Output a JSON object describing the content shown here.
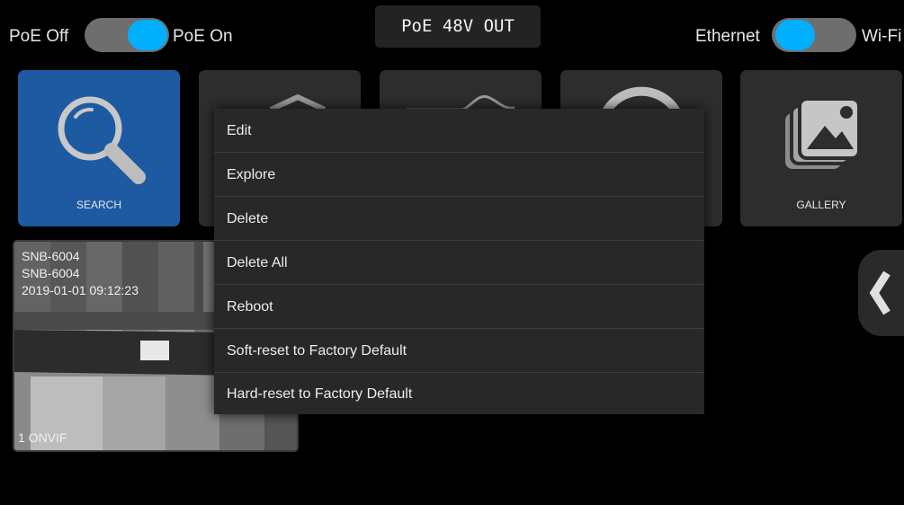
{
  "topbar": {
    "poe_off_label": "PoE Off",
    "poe_on_label": "PoE On",
    "poe_status": "PoE 48V OUT",
    "ethernet_label": "Ethernet",
    "wifi_label": "Wi-Fi",
    "poe_switch_state": "on",
    "net_switch_state": "ethernet"
  },
  "tiles": [
    {
      "label": "SEARCH",
      "icon": "magnifier-icon"
    },
    {
      "label": "",
      "icon": "video-icon"
    },
    {
      "label": "",
      "icon": "waveform-icon"
    },
    {
      "label": "",
      "icon": "circle-icon"
    },
    {
      "label": "GALLERY",
      "icon": "gallery-icon"
    }
  ],
  "camera": {
    "model": "SNB-6004",
    "name": "SNB-6004",
    "timestamp": "2019-01-01 09:12:23",
    "protocol": "1 ONVIF"
  },
  "menu": {
    "items": [
      "Edit",
      "Explore",
      "Delete",
      "Delete All",
      "Reboot",
      "Soft-reset to Factory Default",
      "Hard-reset to Factory Default"
    ]
  },
  "colors": {
    "accent": "#00b0ff",
    "search_tile": "#1d5aa1",
    "tile": "#2d2d2d",
    "menu_bg": "#282828"
  }
}
